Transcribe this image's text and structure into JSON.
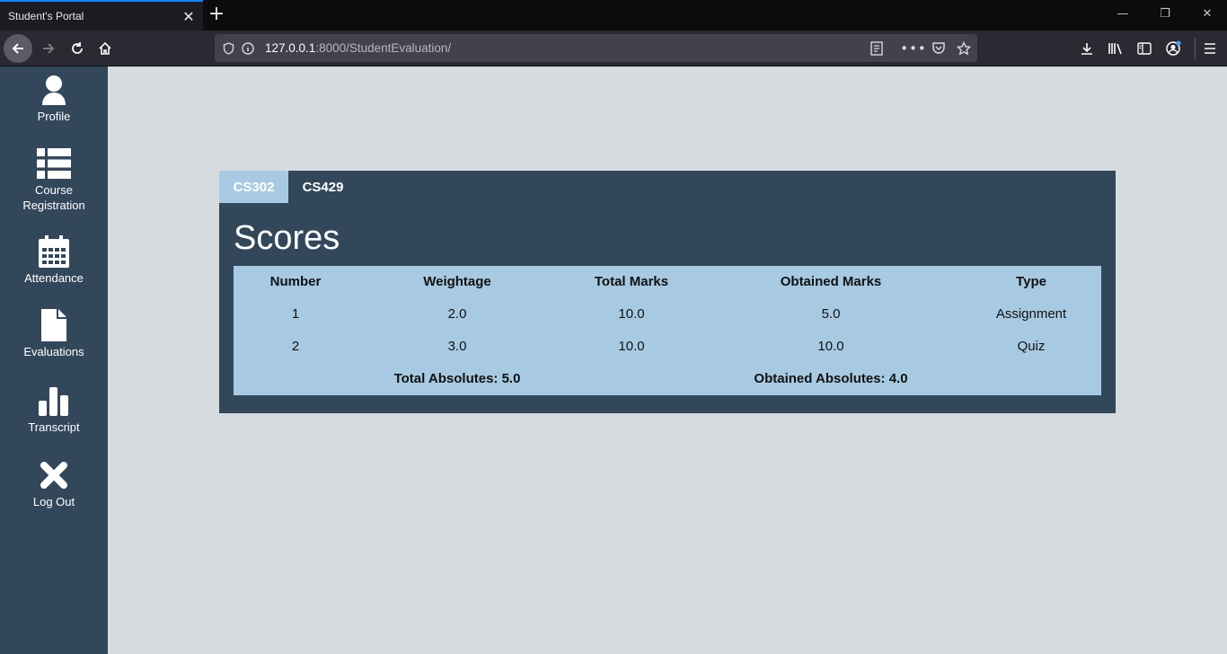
{
  "browser": {
    "tab_title": "Student's Portal",
    "url_host": "127.0.0.1",
    "url_rest": ":8000/StudentEvaluation/"
  },
  "sidebar": {
    "items": [
      {
        "label": "Profile",
        "icon": "user-icon"
      },
      {
        "label": "Course Registration",
        "icon": "list-icon"
      },
      {
        "label": "Attendance",
        "icon": "calendar-icon"
      },
      {
        "label": "Evaluations",
        "icon": "file-icon"
      },
      {
        "label": "Transcript",
        "icon": "bar-chart-icon"
      },
      {
        "label": "Log Out",
        "icon": "close-x-icon"
      }
    ]
  },
  "tabs": [
    {
      "label": "CS302",
      "active": true
    },
    {
      "label": "CS429",
      "active": false
    }
  ],
  "scores": {
    "title": "Scores",
    "columns": [
      "Number",
      "Weightage",
      "Total Marks",
      "Obtained Marks",
      "Type"
    ],
    "rows": [
      [
        "1",
        "2.0",
        "10.0",
        "5.0",
        "Assignment"
      ],
      [
        "2",
        "3.0",
        "10.0",
        "10.0",
        "Quiz"
      ]
    ],
    "total_absolutes": "Total Absolutes: 5.0",
    "obtained_absolutes": "Obtained Absolutes: 4.0"
  },
  "colors": {
    "sidebar": "#33475b",
    "table": "#a7cae2",
    "background": "#d6dbe0"
  }
}
